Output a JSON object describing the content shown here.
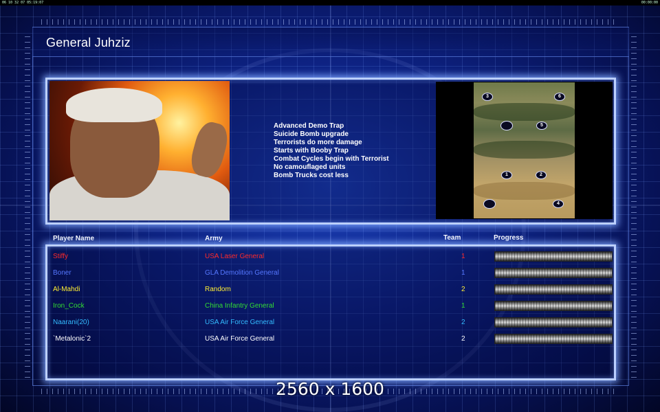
{
  "system_bar": {
    "left_text": "06 10 32 07 05:19:07",
    "right_text": "00:00:00"
  },
  "title": "General Juhziz",
  "traits": [
    "Advanced Demo Trap",
    "Suicide Bomb upgrade",
    "Terrorists do more damage",
    "Starts with Booby Trap",
    "Combat Cycles begin with Terrorist",
    "No camouflaged units",
    "Bomb Trucks cost less"
  ],
  "map_spots": [
    "3",
    "6",
    "",
    "5",
    "1",
    "2",
    "",
    "4"
  ],
  "table": {
    "headers": {
      "player": "Player Name",
      "army": "Army",
      "team": "Team",
      "progress": "Progress"
    },
    "rows": [
      {
        "player": "Stiffy",
        "army": "USA Laser General",
        "team": "1",
        "color": "#ff2a2a",
        "progress": 0
      },
      {
        "player": "Boner",
        "army": "GLA Demolition General",
        "team": "1",
        "color": "#5577ff",
        "progress": 0
      },
      {
        "player": "Al-Mahdi",
        "army": "Random",
        "team": "2",
        "color": "#ffee33",
        "progress": 0
      },
      {
        "player": "Iron_Cock",
        "army": "China Infantry General",
        "team": "1",
        "color": "#33dd33",
        "progress": 0
      },
      {
        "player": "Naarani(20)",
        "army": "USA Air Force General",
        "team": "2",
        "color": "#33bbff",
        "progress": 0
      },
      {
        "player": "`Metalonic`2",
        "army": "USA Air Force General",
        "team": "2",
        "color": "#ffffff",
        "progress": 0
      }
    ]
  },
  "resolution_text": "2560 x 1600"
}
